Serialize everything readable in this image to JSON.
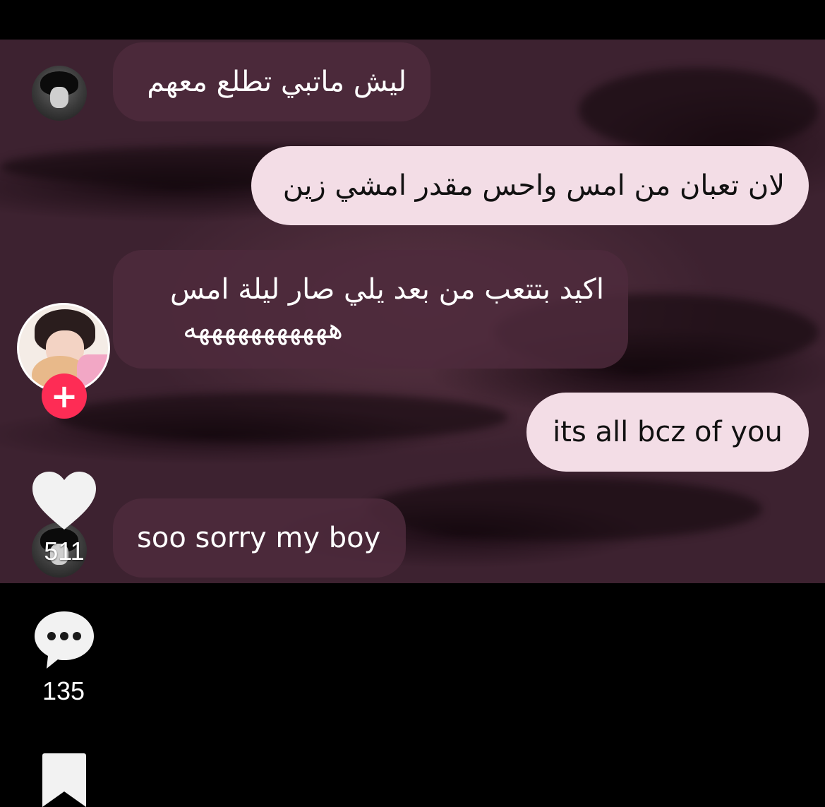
{
  "chat": {
    "messages": [
      {
        "side": "in",
        "text": "ليش ماتبي تطلع معهم"
      },
      {
        "side": "out",
        "text": "لان تعبان من امس واحس مقدر امشي زين"
      },
      {
        "side": "in",
        "line1": "اكيد بتتعب من بعد يلي صار ليلة امس",
        "line2": "هههههههههههه"
      },
      {
        "side": "out",
        "text": "its all bcz of you"
      },
      {
        "side": "in",
        "text": "soo sorry my boy"
      }
    ]
  },
  "actions": {
    "follow_label": "+",
    "likes": "511",
    "comments": "135"
  },
  "colors": {
    "follow": "#fe2c55",
    "incoming_bubble": "#4e2a3c",
    "outgoing_bubble": "#f3dde6"
  }
}
